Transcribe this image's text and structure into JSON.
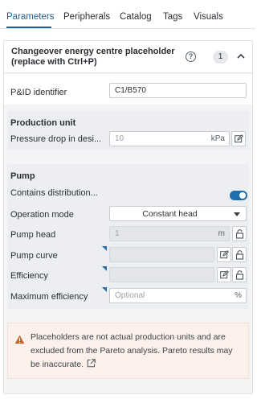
{
  "tabs": [
    {
      "label": "Parameters",
      "active": true
    },
    {
      "label": "Peripherals",
      "active": false
    },
    {
      "label": "Catalog",
      "active": false
    },
    {
      "label": "Tags",
      "active": false
    },
    {
      "label": "Visuals",
      "active": false
    }
  ],
  "panel": {
    "title": "Changeover energy centre placeholder (replace with Ctrl+P)",
    "help_symbol": "?",
    "count": "1",
    "collapse_icon": "chevron-up-icon"
  },
  "pid": {
    "label": "P&ID identifier",
    "value": "C1/B570"
  },
  "production_unit": {
    "title": "Production unit",
    "pressure_drop": {
      "label": "Pressure drop in desi...",
      "value": "10",
      "unit": "kPa",
      "icon": "edit-icon"
    }
  },
  "pump": {
    "title": "Pump",
    "contains_distribution": {
      "label": "Contains distribution...",
      "checked": true
    },
    "operation_mode": {
      "label": "Operation mode",
      "value": "Constant head"
    },
    "pump_head": {
      "label": "Pump head",
      "value": "1",
      "unit": "m",
      "icon": "lock-icon"
    },
    "pump_curve": {
      "label": "Pump curve",
      "icons": [
        "edit-icon",
        "lock-icon"
      ]
    },
    "efficiency": {
      "label": "Efficiency",
      "icons": [
        "edit-icon",
        "lock-icon"
      ]
    },
    "maximum_efficiency": {
      "label": "Maximum efficiency",
      "placeholder": "Optional",
      "unit": "%"
    }
  },
  "warning": {
    "text": "Placeholders are not actual production units and are excluded from the Pareto analysis. Pareto results may be inaccurate.",
    "icon": "warning-icon",
    "link_icon": "external-link-icon"
  },
  "colors": {
    "accent": "#1f5f8f",
    "toggle_on": "#1f6fae",
    "warning_bg": "#fbf1ea",
    "warning_icon": "#c0662a"
  }
}
